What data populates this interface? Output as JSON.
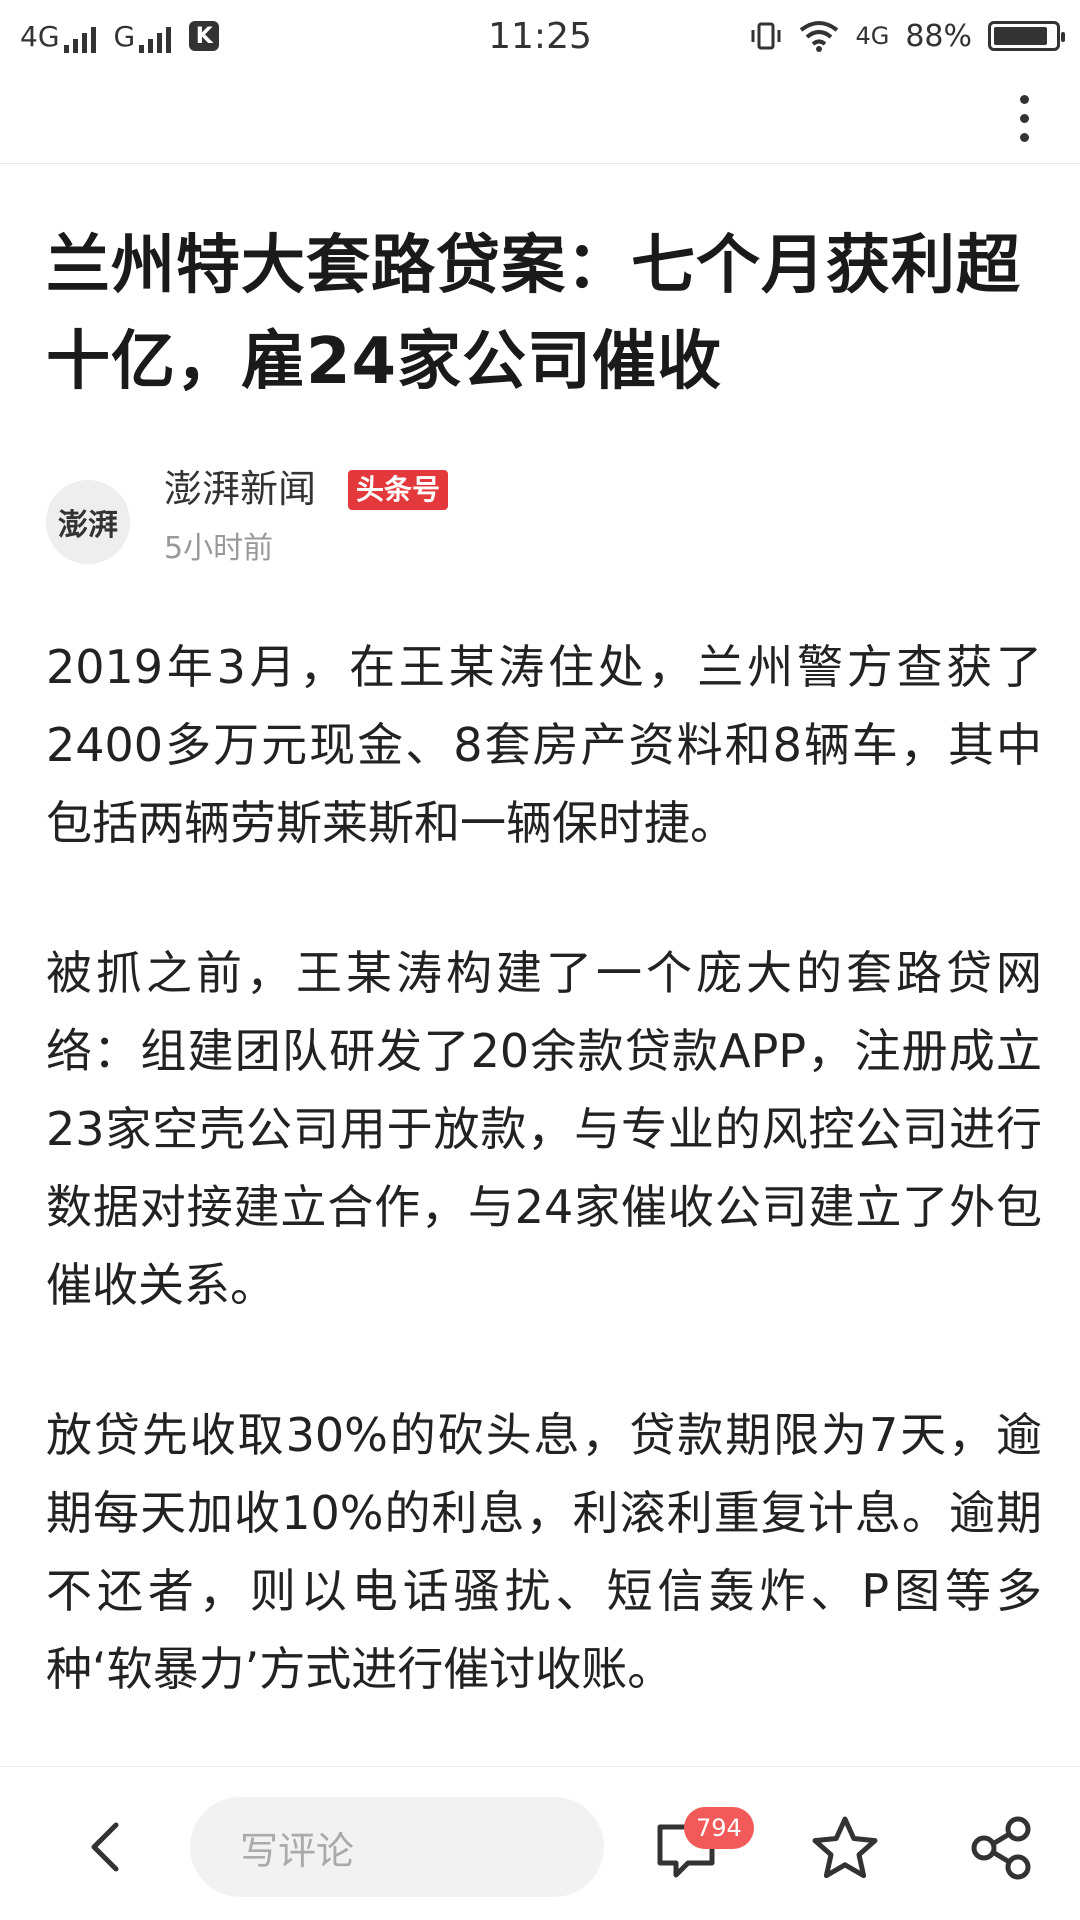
{
  "status_bar": {
    "net1_label": "4G",
    "net2_label": "G",
    "app_badge": "K",
    "time": "11:25",
    "net_right_label": "4G",
    "battery_text": "88%",
    "battery_level": 0.88
  },
  "article": {
    "title": "兰州特大套路贷案：七个月获利超十亿，雇24家公司催收",
    "author": {
      "avatar_text": "澎湃",
      "name": "澎湃新闻",
      "badge": "头条号",
      "time": "5小时前"
    },
    "paragraphs": [
      "2019年3月，在王某涛住处，兰州警方查获了2400多万元现金、8套房产资料和8辆车，其中包括两辆劳斯莱斯和一辆保时捷。",
      "被抓之前，王某涛构建了一个庞大的套路贷网络：组建团队研发了20余款贷款APP，注册成立23家空壳公司用于放款，与专业的风控公司进行数据对接建立合作，与24家催收公司建立了外包催收关系。",
      "放贷先收取30%的砍头息，贷款期限为7天，逾期每天加收10%的利息，利滚利重复计息。逾期不还者，则以电话骚扰、短信轰炸、P图等多种‘软暴力’方式进行催讨收账。"
    ]
  },
  "bottom_bar": {
    "comment_placeholder": "写评论",
    "comment_count": "794"
  },
  "icons": {
    "more": "more-vertical-icon",
    "back": "back-arrow-icon",
    "comments": "comment-bubble-icon",
    "favorite": "star-icon",
    "share": "share-icon"
  }
}
